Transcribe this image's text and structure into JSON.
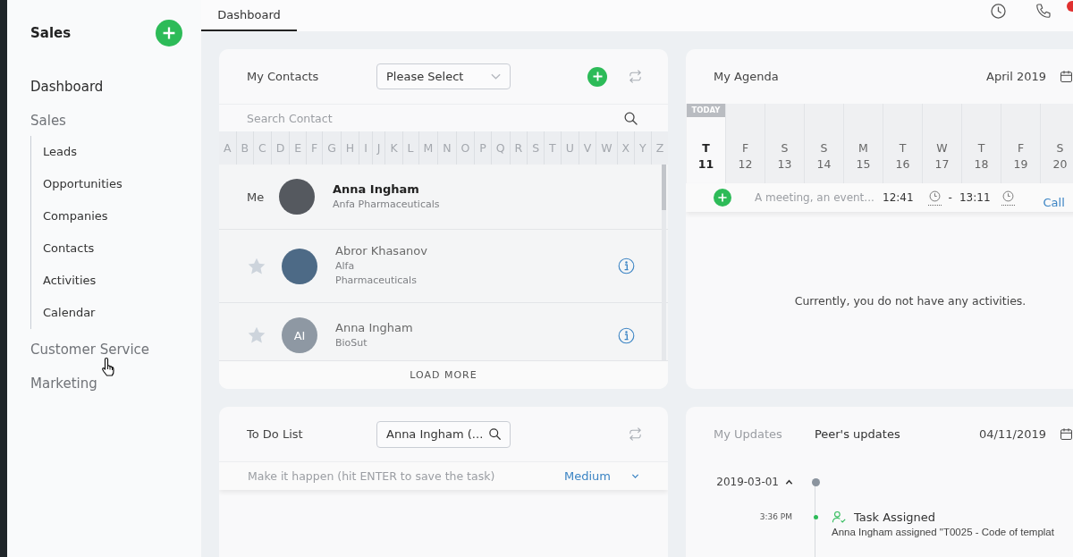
{
  "sidebar": {
    "title": "Sales",
    "items": [
      {
        "label": "Dashboard",
        "selected": true
      },
      {
        "label": "Sales",
        "selected": false,
        "children": [
          {
            "label": "Leads",
            "selected": false
          },
          {
            "label": "Opportunities",
            "selected": false
          },
          {
            "label": "Companies",
            "selected": false
          },
          {
            "label": "Contacts",
            "selected": false
          },
          {
            "label": "Activities",
            "selected": false
          },
          {
            "label": "Calendar",
            "selected": false
          }
        ]
      },
      {
        "label": "Customer Service",
        "selected": false
      },
      {
        "label": "Marketing",
        "selected": false
      }
    ]
  },
  "tabs": [
    {
      "label": "Dashboard",
      "selected": true
    }
  ],
  "contacts": {
    "title": "My Contacts",
    "filter": {
      "value": "Please Select"
    },
    "search": {
      "placeholder": "Search Contact"
    },
    "letters": [
      "A",
      "B",
      "C",
      "D",
      "E",
      "F",
      "G",
      "H",
      "I",
      "J",
      "K",
      "L",
      "M",
      "N",
      "O",
      "P",
      "Q",
      "R",
      "S",
      "T",
      "U",
      "V",
      "W",
      "X",
      "Y",
      "Z"
    ],
    "me": {
      "label": "Me",
      "name": "Anna Ingham",
      "company": "Anfa Pharmaceuticals",
      "avatar": {
        "kind": "photo"
      }
    },
    "list": [
      {
        "name": "Abror Khasanov",
        "company": "Alfa\nPharmaceuticals",
        "starred": false,
        "avatar": {
          "kind": "photo"
        }
      },
      {
        "name": "Anna Ingham",
        "company": "BioSut",
        "starred": false,
        "avatar": {
          "kind": "initials",
          "text": "AI"
        }
      }
    ],
    "load_more": "LOAD MORE"
  },
  "agenda": {
    "title": "My Agenda",
    "month": "April 2019",
    "today_label": "TODAY",
    "days": [
      {
        "weekday": "T",
        "date": "11",
        "selected": true
      },
      {
        "weekday": "F",
        "date": "12",
        "selected": false
      },
      {
        "weekday": "S",
        "date": "13",
        "selected": false
      },
      {
        "weekday": "S",
        "date": "14",
        "selected": false
      },
      {
        "weekday": "M",
        "date": "15",
        "selected": false
      },
      {
        "weekday": "T",
        "date": "16",
        "selected": false
      },
      {
        "weekday": "W",
        "date": "17",
        "selected": false
      },
      {
        "weekday": "T",
        "date": "18",
        "selected": false
      },
      {
        "weekday": "F",
        "date": "19",
        "selected": false
      },
      {
        "weekday": "S",
        "date": "20",
        "selected": false
      }
    ],
    "new_event": {
      "placeholder": "A meeting, an event...",
      "start": "12:41",
      "separator": "-",
      "end": "13:11",
      "type": "Call"
    },
    "empty_message": "Currently, you do not have any activities."
  },
  "todo": {
    "title": "To Do List",
    "assignee": {
      "value": "Anna Ingham (..."
    },
    "new_task": {
      "placeholder": "Make it happen (hit ENTER to save the task)",
      "priority": "Medium"
    }
  },
  "updates": {
    "tabs": [
      {
        "label": "My Updates",
        "selected": false
      },
      {
        "label": "Peer's updates",
        "selected": true
      }
    ],
    "date": "04/11/2019",
    "groups": [
      {
        "date": "2019-03-01",
        "expanded": true,
        "entries": [
          {
            "time": "3:36 PM",
            "title": "Task Assigned",
            "text": "Anna Ingham assigned \"T0025 - Code of templat"
          }
        ]
      }
    ]
  }
}
